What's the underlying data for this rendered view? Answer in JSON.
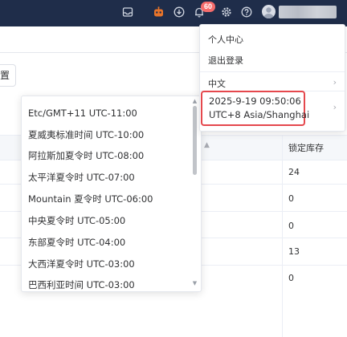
{
  "topbar": {
    "notification_count": "60",
    "icons": [
      "inbox-icon",
      "robot-icon",
      "download-icon",
      "bell-icon",
      "settings-icon",
      "help-icon",
      "avatar"
    ]
  },
  "page": {
    "partial_button_label": "置",
    "table": {
      "column_header": "锁定库存",
      "values": [
        "24",
        "0",
        "0",
        "13",
        "0"
      ]
    }
  },
  "user_menu": {
    "profile": "个人中心",
    "logout": "退出登录",
    "language": "中文",
    "datetime": "2025-9-19 09:50:06",
    "timezone": "UTC+8 Asia/Shanghai"
  },
  "timezone_list": [
    "Etc/GMT+11 UTC-11:00",
    "夏威夷标准时间 UTC-10:00",
    "阿拉斯加夏令时 UTC-08:00",
    "太平洋夏令时 UTC-07:00",
    "Mountain 夏令时 UTC-06:00",
    "中央夏令时 UTC-05:00",
    "东部夏令时 UTC-04:00",
    "大西洋夏令时 UTC-03:00",
    "巴西利亚时间 UTC-03:00"
  ],
  "colors": {
    "topbar": "#1f2d4a",
    "badge": "#f56c6c",
    "highlight": "#e5484d",
    "robot": "#e8742a"
  }
}
